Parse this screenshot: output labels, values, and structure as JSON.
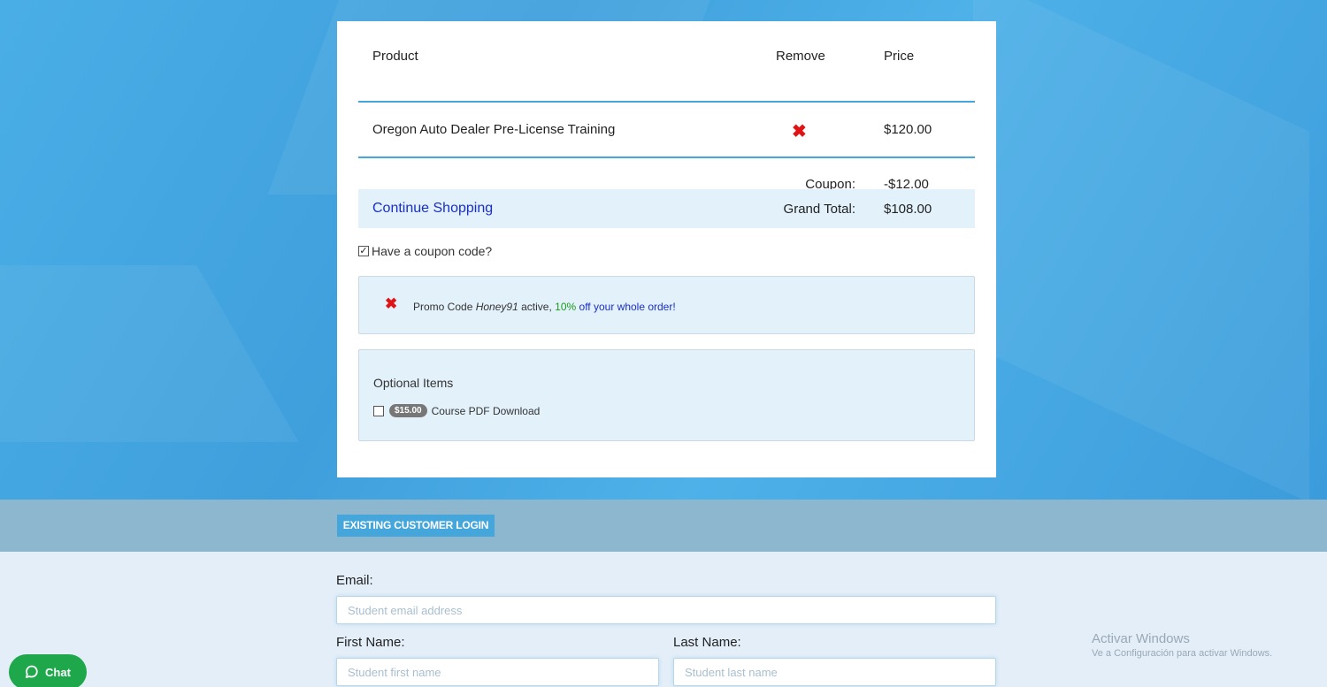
{
  "cart": {
    "headers": {
      "product": "Product",
      "remove": "Remove",
      "price": "Price"
    },
    "items": [
      {
        "product": "Oregon Auto Dealer Pre-License Training",
        "remove_icon": "red-x-icon",
        "price": "$120.00"
      }
    ],
    "coupon": {
      "label": "Coupon:",
      "value": "-$12.00"
    },
    "total": {
      "continue_label": "Continue Shopping",
      "label": "Grand Total:",
      "value": "$108.00"
    }
  },
  "coupon_toggle": {
    "checked": true,
    "label": "Have a coupon code?"
  },
  "promo": {
    "prefix": "Promo Code",
    "code": "Honey91",
    "active_text": "active,",
    "discount": "10%",
    "discount_tail": "off your whole order!"
  },
  "optional": {
    "title": "Optional Items",
    "items": [
      {
        "price": "$15.00",
        "label": "Course PDF Download",
        "checked": false
      }
    ]
  },
  "login": {
    "button_label": "EXISTING CUSTOMER LOGIN"
  },
  "form": {
    "email_label": "Email:",
    "email_placeholder": "Student email address",
    "first_label": "First Name:",
    "first_placeholder": "Student first name",
    "last_label": "Last Name:",
    "last_placeholder": "Student last name"
  },
  "watermark": {
    "title": "Activar Windows",
    "subtitle": "Ve a Configuración para activar Windows."
  },
  "chat": {
    "label": "Chat",
    "icon": "chat-bubble-icon"
  },
  "colors": {
    "accent": "#45a6dc",
    "remove_red": "#e01414",
    "link_blue": "#1a2fc8",
    "promo_green": "#1b9a1b",
    "chat_green": "#1fa84b"
  }
}
